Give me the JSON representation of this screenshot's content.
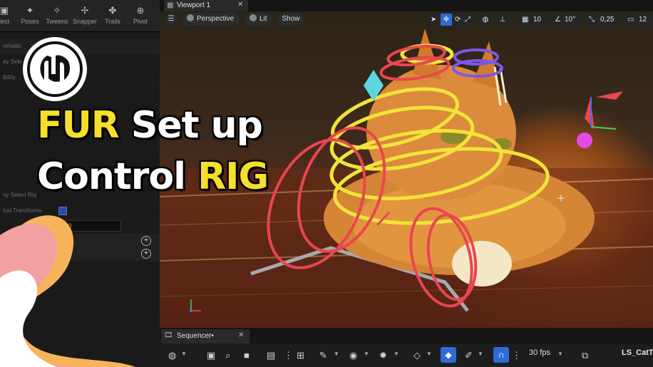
{
  "left_panel": {
    "mode_tabs": [
      {
        "label": "lect",
        "icon": "select-icon"
      },
      {
        "label": "Poses",
        "icon": "poses-icon"
      },
      {
        "label": "Tweens",
        "icon": "tweens-icon"
      },
      {
        "label": "Snapper",
        "icon": "snapper-icon"
      },
      {
        "label": "Trails",
        "icon": "trails-icon"
      },
      {
        "label": "Pivot",
        "icon": "pivot-icon"
      }
    ],
    "rows": [
      "nimatio",
      "ay Sele",
      "ibility",
      "",
      "",
      "",
      "",
      "",
      "ny Select Rig",
      "ical Transforms"
    ],
    "value_field": "1,0"
  },
  "viewport": {
    "tab_label": "Viewport 1",
    "perspective_label": "Perspective",
    "lit_label": "Lit",
    "show_label": "Show",
    "grid_snap": "10",
    "rotation_snap": "10°",
    "scale_snap": "0,25",
    "camera_speed": "12"
  },
  "overlay": {
    "title_word1": "FUR",
    "title_word2": "Set up",
    "title_word3": "Control",
    "title_word4": "RIG",
    "logo": "unreal-engine-logo"
  },
  "sequencer": {
    "tab_label": "Sequencer•",
    "fps_label": "30 fps",
    "sequence_name": "LS_CatTe"
  },
  "colors": {
    "title_yellow": "#f5df2a",
    "rig_yellow": "#f2e33a",
    "rig_red": "#e9464f",
    "rig_purple": "#7d57e8",
    "snap_active": "#2f6bd8",
    "brand_orange": "#f3a34a"
  }
}
